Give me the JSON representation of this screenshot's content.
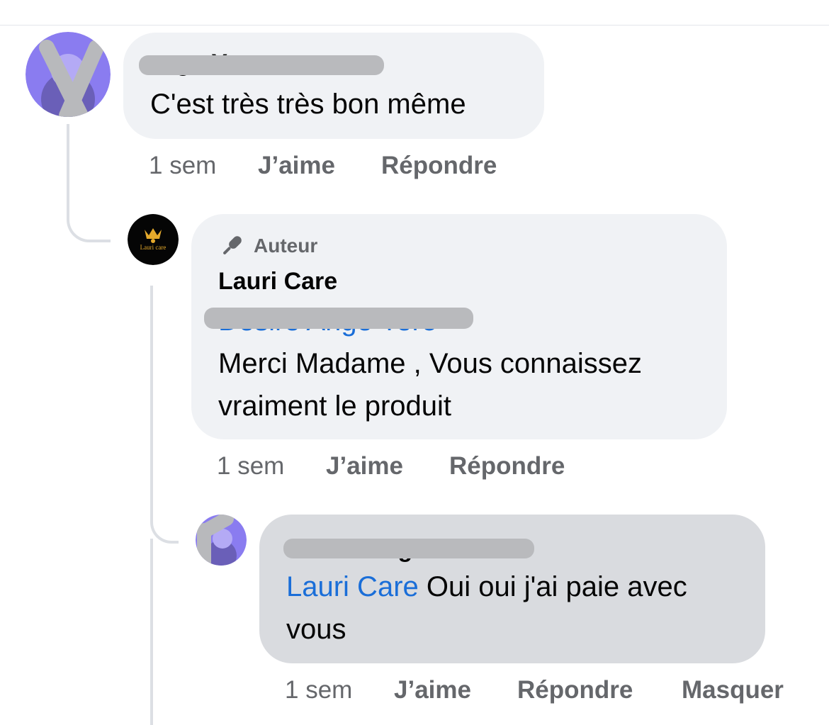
{
  "comments": [
    {
      "author_redacted": "…go Yero",
      "text": "C'est très très bon même",
      "time": "1 sem",
      "like_label": "J’aime",
      "reply_label": "Répondre"
    },
    {
      "badge": "Auteur",
      "author": "Lauri Care",
      "avatar_logo_text": "Lauri care",
      "mention_redacted": "Desiré Ange Yero",
      "text": "Merci Madame , Vous connaissez vraiment le produit",
      "time": "1 sem",
      "like_label": "J’aime",
      "reply_label": "Répondre"
    },
    {
      "author_redacted": "Désiré Ange Yero",
      "mention": "Lauri Care",
      "text": " Oui oui j'ai paie avec vous",
      "time": "1 sem",
      "like_label": "J’aime",
      "reply_label": "Répondre",
      "hide_label": "Masquer"
    }
  ],
  "colors": {
    "bubble": "#f0f2f5",
    "bubble_highlight": "#d9dbdf",
    "mention": "#1a6ed8",
    "meta": "#65676b",
    "redaction": "#b9babd"
  },
  "icons": [
    "microphone-icon"
  ]
}
